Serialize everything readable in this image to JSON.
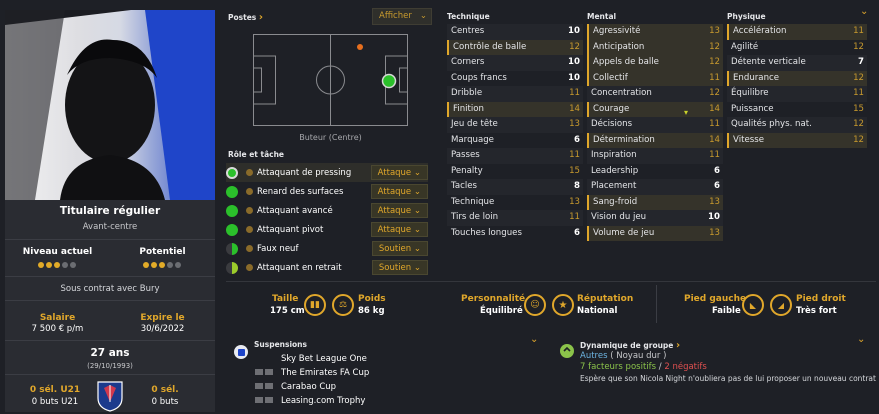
{
  "profile": {
    "status": "Titulaire régulier",
    "position": "Avant-centre",
    "current_ability_label": "Niveau actuel",
    "potential_label": "Potentiel",
    "current_ability_stars": 3,
    "potential_stars": 3,
    "contract": "Sous contrat avec Bury",
    "salary_label": "Salaire",
    "salary_value": "7 500 € p/m",
    "expires_label": "Expire le",
    "expires_value": "30/6/2022",
    "age": "27 ans",
    "dob": "(29/10/1993)",
    "u21_caps_label": "0 sél. U21",
    "u21_goals": "0 buts U21",
    "caps_label": "0 sél.",
    "goals": "0 buts"
  },
  "positions": {
    "header": "Postes",
    "dropdown": "Afficher",
    "pitch_caption": "Buteur (Centre)"
  },
  "roles": {
    "header": "Rôle et tâche",
    "items": [
      {
        "name": "Attaquant de pressing",
        "duty": "Attaque",
        "level": "full"
      },
      {
        "name": "Renard des surfaces",
        "duty": "Attaque",
        "level": "full"
      },
      {
        "name": "Attaquant avancé",
        "duty": "Attaque",
        "level": "full"
      },
      {
        "name": "Attaquant pivot",
        "duty": "Attaque",
        "level": "full"
      },
      {
        "name": "Faux neuf",
        "duty": "Soutien",
        "level": "half"
      },
      {
        "name": "Attaquant en retrait",
        "duty": "Soutien",
        "level": "half"
      }
    ]
  },
  "technique": {
    "header": "Technique",
    "rows": [
      {
        "label": "Centres",
        "value": "10",
        "style": "white",
        "hl": false
      },
      {
        "label": "Contrôle de balle",
        "value": "12",
        "style": "gold",
        "hl": true
      },
      {
        "label": "Corners",
        "value": "10",
        "style": "white",
        "hl": false
      },
      {
        "label": "Coups francs",
        "value": "10",
        "style": "white",
        "hl": false
      },
      {
        "label": "Dribble",
        "value": "11",
        "style": "gold",
        "hl": false
      },
      {
        "label": "Finition",
        "value": "14",
        "style": "gold",
        "hl": true
      },
      {
        "label": "Jeu de tête",
        "value": "13",
        "style": "gold",
        "hl": false
      },
      {
        "label": "Marquage",
        "value": "6",
        "style": "white",
        "hl": false
      },
      {
        "label": "Passes",
        "value": "11",
        "style": "gold",
        "hl": false
      },
      {
        "label": "Penalty",
        "value": "15",
        "style": "gold",
        "hl": false
      },
      {
        "label": "Tacles",
        "value": "8",
        "style": "white",
        "hl": false
      },
      {
        "label": "Technique",
        "value": "13",
        "style": "gold",
        "hl": false
      },
      {
        "label": "Tirs de loin",
        "value": "11",
        "style": "gold",
        "hl": false
      },
      {
        "label": "Touches longues",
        "value": "6",
        "style": "white",
        "hl": false
      }
    ]
  },
  "mental": {
    "header": "Mental",
    "rows": [
      {
        "label": "Agressivité",
        "value": "13",
        "style": "gold",
        "hl": true
      },
      {
        "label": "Anticipation",
        "value": "12",
        "style": "gold",
        "hl": true
      },
      {
        "label": "Appels de balle",
        "value": "12",
        "style": "gold",
        "hl": true
      },
      {
        "label": "Collectif",
        "value": "11",
        "style": "gold",
        "hl": true
      },
      {
        "label": "Concentration",
        "value": "12",
        "style": "gold",
        "hl": false
      },
      {
        "label": "Courage",
        "value": "14",
        "style": "gold",
        "hl": true
      },
      {
        "label": "Décisions",
        "value": "11",
        "style": "gold",
        "hl": false
      },
      {
        "label": "Détermination",
        "value": "14",
        "style": "gold",
        "hl": true
      },
      {
        "label": "Inspiration",
        "value": "11",
        "style": "gold",
        "hl": false
      },
      {
        "label": "Leadership",
        "value": "6",
        "style": "white",
        "hl": false
      },
      {
        "label": "Placement",
        "value": "6",
        "style": "white",
        "hl": false
      },
      {
        "label": "Sang-froid",
        "value": "13",
        "style": "gold",
        "hl": true
      },
      {
        "label": "Vision du jeu",
        "value": "10",
        "style": "white",
        "hl": false
      },
      {
        "label": "Volume de jeu",
        "value": "13",
        "style": "gold",
        "hl": true
      }
    ]
  },
  "physique": {
    "header": "Physique",
    "rows": [
      {
        "label": "Accélération",
        "value": "11",
        "style": "gold",
        "hl": true
      },
      {
        "label": "Agilité",
        "value": "12",
        "style": "gold",
        "hl": false
      },
      {
        "label": "Détente verticale",
        "value": "7",
        "style": "white",
        "hl": false
      },
      {
        "label": "Endurance",
        "value": "12",
        "style": "gold",
        "hl": true
      },
      {
        "label": "Équilibre",
        "value": "11",
        "style": "gold",
        "hl": false
      },
      {
        "label": "Puissance",
        "value": "15",
        "style": "gold",
        "hl": false
      },
      {
        "label": "Qualités phys. nat.",
        "value": "12",
        "style": "gold",
        "hl": false
      },
      {
        "label": "Vitesse",
        "value": "12",
        "style": "gold",
        "hl": true
      }
    ]
  },
  "bio": {
    "height_label": "Taille",
    "height_value": "175 cm",
    "weight_label": "Poids",
    "weight_value": "86 kg",
    "personality_label": "Personnalité",
    "personality_value": "Équilibré",
    "reputation_label": "Réputation",
    "reputation_value": "National",
    "left_foot_label": "Pied gauche",
    "left_foot_value": "Faible",
    "right_foot_label": "Pied droit",
    "right_foot_value": "Très fort"
  },
  "suspensions": {
    "header": "Suspensions",
    "items": [
      "Sky Bet League One",
      "The Emirates FA Cup",
      "Carabao Cup",
      "Leasing.com Trophy"
    ]
  },
  "dynamics": {
    "header": "Dynamique de groupe",
    "group": "Autres",
    "group_note": "( Noyau dur )",
    "positives": "7 facteurs positifs",
    "separator": "/",
    "negatives": "2 négatifs",
    "quote": "Espère que son Nicola Night n'oubliera pas de lui proposer un nouveau contrat"
  },
  "colors": {
    "accent": "#e0a72b",
    "positive": "#8bc34a",
    "negative": "#e05050",
    "link": "#6db3e0"
  }
}
